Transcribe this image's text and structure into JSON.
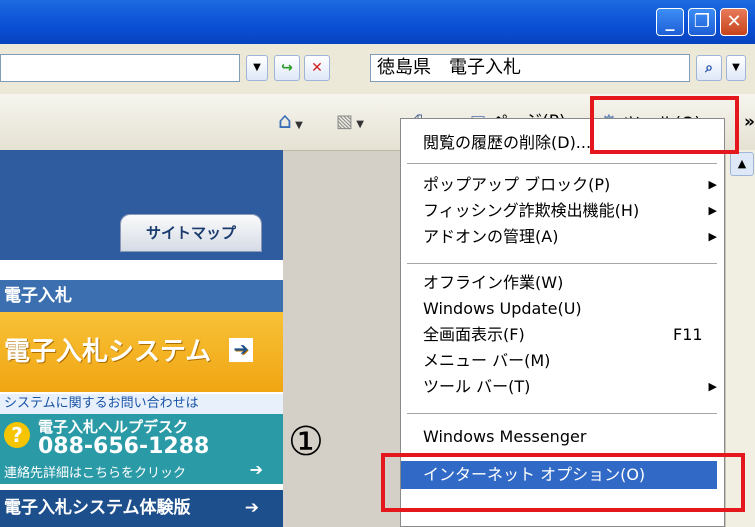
{
  "titlebar": {
    "minimize_glyph": "_",
    "restore_glyph": "❐",
    "close_glyph": "✕"
  },
  "addressbar": {
    "search_value": "徳島県　電子入札",
    "go_glyph": "↪",
    "stop_glyph": "✕",
    "search_glyph": "⌕"
  },
  "commandbar": {
    "page_label": "ページ(P)",
    "tools_label": "ツール(O)",
    "overflow": "»"
  },
  "page": {
    "sitemap_tab": "サイトマップ",
    "section_heading": "電子入札",
    "system_button": "電子入札システム",
    "inquiry_text": "システムに関するお問い合わせは",
    "helpdesk_title": "電子入札ヘルプデスク",
    "helpdesk_phone": "088-656-1288",
    "helpdesk_note": "連絡先詳細はこちらをクリック",
    "trial_label": "電子入札システム体験版"
  },
  "tools_menu": {
    "items": [
      {
        "label": "閲覧の履歴の削除(D)...",
        "shortcut": "",
        "submenu": false
      },
      {
        "label": "ポップアップ ブロック(P)",
        "shortcut": "",
        "submenu": true
      },
      {
        "label": "フィッシング詐欺検出機能(H)",
        "shortcut": "",
        "submenu": true
      },
      {
        "label": "アドオンの管理(A)",
        "shortcut": "",
        "submenu": true
      },
      {
        "label": "オフライン作業(W)",
        "shortcut": "",
        "submenu": false
      },
      {
        "label": "Windows Update(U)",
        "shortcut": "",
        "submenu": false
      },
      {
        "label": "全画面表示(F)",
        "shortcut": "F11",
        "submenu": false
      },
      {
        "label": "メニュー バー(M)",
        "shortcut": "",
        "submenu": false
      },
      {
        "label": "ツール バー(T)",
        "shortcut": "",
        "submenu": true
      },
      {
        "label": "Windows Messenger",
        "shortcut": "",
        "submenu": false
      },
      {
        "label": "インターネット オプション(O)",
        "shortcut": "",
        "submenu": false,
        "highlighted": true
      }
    ]
  },
  "annotation": {
    "step_marker": "①"
  },
  "colors": {
    "highlight_box": "#e4181c",
    "menu_selection": "#3169c6"
  }
}
